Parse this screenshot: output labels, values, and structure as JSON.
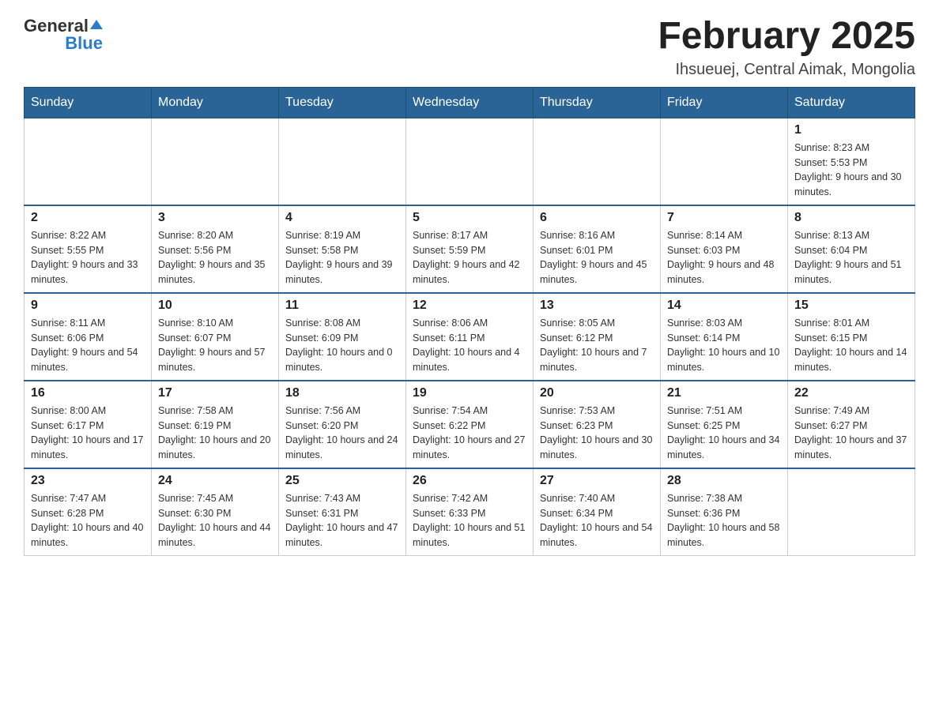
{
  "logo": {
    "text_general": "General",
    "text_blue": "Blue"
  },
  "title": "February 2025",
  "subtitle": "Ihsueuej, Central Aimak, Mongolia",
  "weekdays": [
    "Sunday",
    "Monday",
    "Tuesday",
    "Wednesday",
    "Thursday",
    "Friday",
    "Saturday"
  ],
  "weeks": [
    [
      {
        "day": "",
        "info": ""
      },
      {
        "day": "",
        "info": ""
      },
      {
        "day": "",
        "info": ""
      },
      {
        "day": "",
        "info": ""
      },
      {
        "day": "",
        "info": ""
      },
      {
        "day": "",
        "info": ""
      },
      {
        "day": "1",
        "info": "Sunrise: 8:23 AM\nSunset: 5:53 PM\nDaylight: 9 hours and 30 minutes."
      }
    ],
    [
      {
        "day": "2",
        "info": "Sunrise: 8:22 AM\nSunset: 5:55 PM\nDaylight: 9 hours and 33 minutes."
      },
      {
        "day": "3",
        "info": "Sunrise: 8:20 AM\nSunset: 5:56 PM\nDaylight: 9 hours and 35 minutes."
      },
      {
        "day": "4",
        "info": "Sunrise: 8:19 AM\nSunset: 5:58 PM\nDaylight: 9 hours and 39 minutes."
      },
      {
        "day": "5",
        "info": "Sunrise: 8:17 AM\nSunset: 5:59 PM\nDaylight: 9 hours and 42 minutes."
      },
      {
        "day": "6",
        "info": "Sunrise: 8:16 AM\nSunset: 6:01 PM\nDaylight: 9 hours and 45 minutes."
      },
      {
        "day": "7",
        "info": "Sunrise: 8:14 AM\nSunset: 6:03 PM\nDaylight: 9 hours and 48 minutes."
      },
      {
        "day": "8",
        "info": "Sunrise: 8:13 AM\nSunset: 6:04 PM\nDaylight: 9 hours and 51 minutes."
      }
    ],
    [
      {
        "day": "9",
        "info": "Sunrise: 8:11 AM\nSunset: 6:06 PM\nDaylight: 9 hours and 54 minutes."
      },
      {
        "day": "10",
        "info": "Sunrise: 8:10 AM\nSunset: 6:07 PM\nDaylight: 9 hours and 57 minutes."
      },
      {
        "day": "11",
        "info": "Sunrise: 8:08 AM\nSunset: 6:09 PM\nDaylight: 10 hours and 0 minutes."
      },
      {
        "day": "12",
        "info": "Sunrise: 8:06 AM\nSunset: 6:11 PM\nDaylight: 10 hours and 4 minutes."
      },
      {
        "day": "13",
        "info": "Sunrise: 8:05 AM\nSunset: 6:12 PM\nDaylight: 10 hours and 7 minutes."
      },
      {
        "day": "14",
        "info": "Sunrise: 8:03 AM\nSunset: 6:14 PM\nDaylight: 10 hours and 10 minutes."
      },
      {
        "day": "15",
        "info": "Sunrise: 8:01 AM\nSunset: 6:15 PM\nDaylight: 10 hours and 14 minutes."
      }
    ],
    [
      {
        "day": "16",
        "info": "Sunrise: 8:00 AM\nSunset: 6:17 PM\nDaylight: 10 hours and 17 minutes."
      },
      {
        "day": "17",
        "info": "Sunrise: 7:58 AM\nSunset: 6:19 PM\nDaylight: 10 hours and 20 minutes."
      },
      {
        "day": "18",
        "info": "Sunrise: 7:56 AM\nSunset: 6:20 PM\nDaylight: 10 hours and 24 minutes."
      },
      {
        "day": "19",
        "info": "Sunrise: 7:54 AM\nSunset: 6:22 PM\nDaylight: 10 hours and 27 minutes."
      },
      {
        "day": "20",
        "info": "Sunrise: 7:53 AM\nSunset: 6:23 PM\nDaylight: 10 hours and 30 minutes."
      },
      {
        "day": "21",
        "info": "Sunrise: 7:51 AM\nSunset: 6:25 PM\nDaylight: 10 hours and 34 minutes."
      },
      {
        "day": "22",
        "info": "Sunrise: 7:49 AM\nSunset: 6:27 PM\nDaylight: 10 hours and 37 minutes."
      }
    ],
    [
      {
        "day": "23",
        "info": "Sunrise: 7:47 AM\nSunset: 6:28 PM\nDaylight: 10 hours and 40 minutes."
      },
      {
        "day": "24",
        "info": "Sunrise: 7:45 AM\nSunset: 6:30 PM\nDaylight: 10 hours and 44 minutes."
      },
      {
        "day": "25",
        "info": "Sunrise: 7:43 AM\nSunset: 6:31 PM\nDaylight: 10 hours and 47 minutes."
      },
      {
        "day": "26",
        "info": "Sunrise: 7:42 AM\nSunset: 6:33 PM\nDaylight: 10 hours and 51 minutes."
      },
      {
        "day": "27",
        "info": "Sunrise: 7:40 AM\nSunset: 6:34 PM\nDaylight: 10 hours and 54 minutes."
      },
      {
        "day": "28",
        "info": "Sunrise: 7:38 AM\nSunset: 6:36 PM\nDaylight: 10 hours and 58 minutes."
      },
      {
        "day": "",
        "info": ""
      }
    ]
  ]
}
